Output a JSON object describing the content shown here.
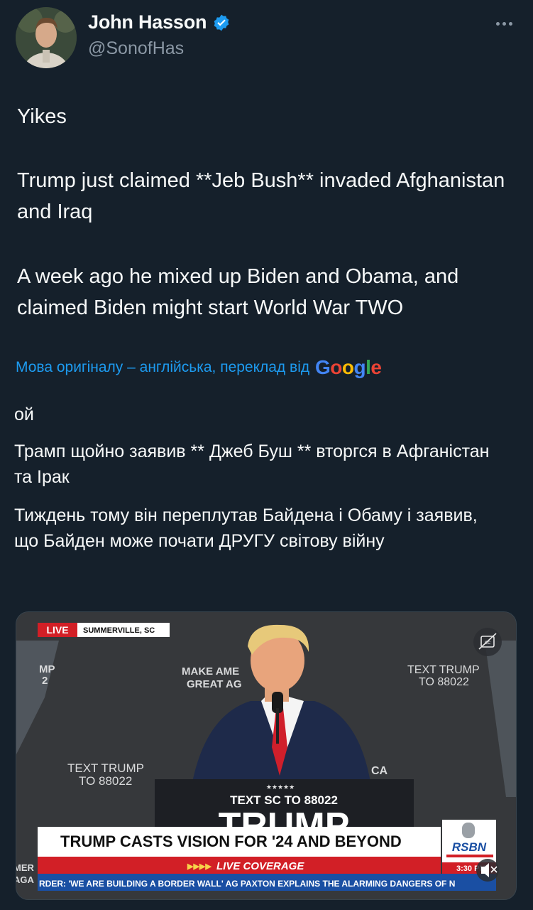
{
  "author": {
    "display_name": "John Hasson",
    "handle": "@SonofHas",
    "verified_icon": "verified-badge-icon"
  },
  "tweet": {
    "line1": "Yikes",
    "line2": "Trump just claimed **Jeb Bush** invaded Afghanistan and Iraq",
    "line3": "A week ago he mixed up Biden and Obama, and claimed Biden might start World War TWO"
  },
  "translation": {
    "notice": "Мова оригіналу – англійська, переклад від",
    "provider": "Google",
    "line1": "ой",
    "line2": "Трамп щойно заявив ** Джеб Буш ** вторгся в Афганістан та Ірак",
    "line3": "Тиждень тому він переплутав Байдена і Обаму і заявив, що Байден може почати ДРУГУ світову війну"
  },
  "video": {
    "live_label": "LIVE",
    "location": "SUMMERVILLE, SC",
    "sign_left_top": "MAKE AME",
    "sign_left_bottom": "GREAT AG",
    "sign_right_top": "TEXT TRUMP",
    "sign_right_bottom": "TO 88022",
    "sign_mid_top": "TEXT TRUMP",
    "sign_mid_bottom": "TO 88022",
    "sign_far_left_top": "MP",
    "sign_far_left_bottom": "2",
    "podium_stars": "★★★★★",
    "podium_text": "TEXT SC TO 88022",
    "podium_big": "TRUMP",
    "partial_ca": "CA",
    "headline": "TRUMP CASTS VISION FOR '24 AND BEYOND",
    "live_coverage": "LIVE COVERAGE",
    "ticker": "RDER: 'WE ARE BUILDING A BORDER WALL'    AG PAXTON EXPLAINS THE ALARMING DANGERS OF N",
    "network": "RSBN",
    "time": "3:30 PM",
    "left_edge_a": "MER",
    "left_edge_b": "AGA"
  }
}
